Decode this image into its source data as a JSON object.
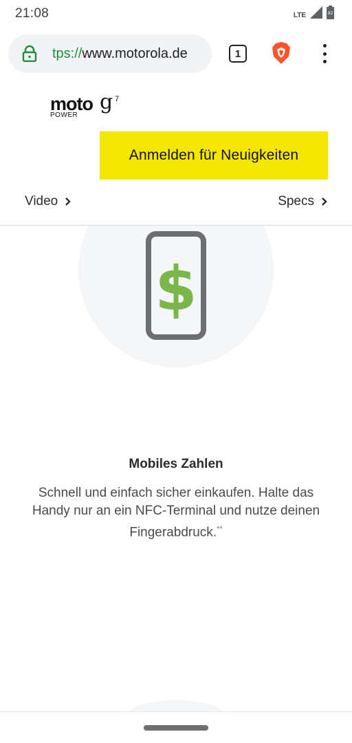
{
  "status_bar": {
    "time": "21:08",
    "network": "LTE",
    "battery_level": "92"
  },
  "browser": {
    "url_scheme": "tps://",
    "url_host": "www.motorola.de",
    "tab_count": "1"
  },
  "header": {
    "logo_main": "moto",
    "logo_g": "g",
    "logo_sup": "7",
    "logo_sub": "POWER",
    "signup_label": "Anmelden für Neuigkeiten",
    "nav_video": "Video",
    "nav_specs": "Specs"
  },
  "feature": {
    "title": "Mobiles Zahlen",
    "description": "Schnell und einfach sicher einkaufen. Halte das Handy nur an ein NFC-Terminal und nutze deinen Fingerabdruck.",
    "footnote": "**"
  },
  "colors": {
    "accent_yellow": "#f3e600",
    "dollar_green": "#7ab648",
    "phone_gray": "#6d6e71",
    "secure_green": "#1e8e3e",
    "brave_orange": "#fb542b"
  }
}
